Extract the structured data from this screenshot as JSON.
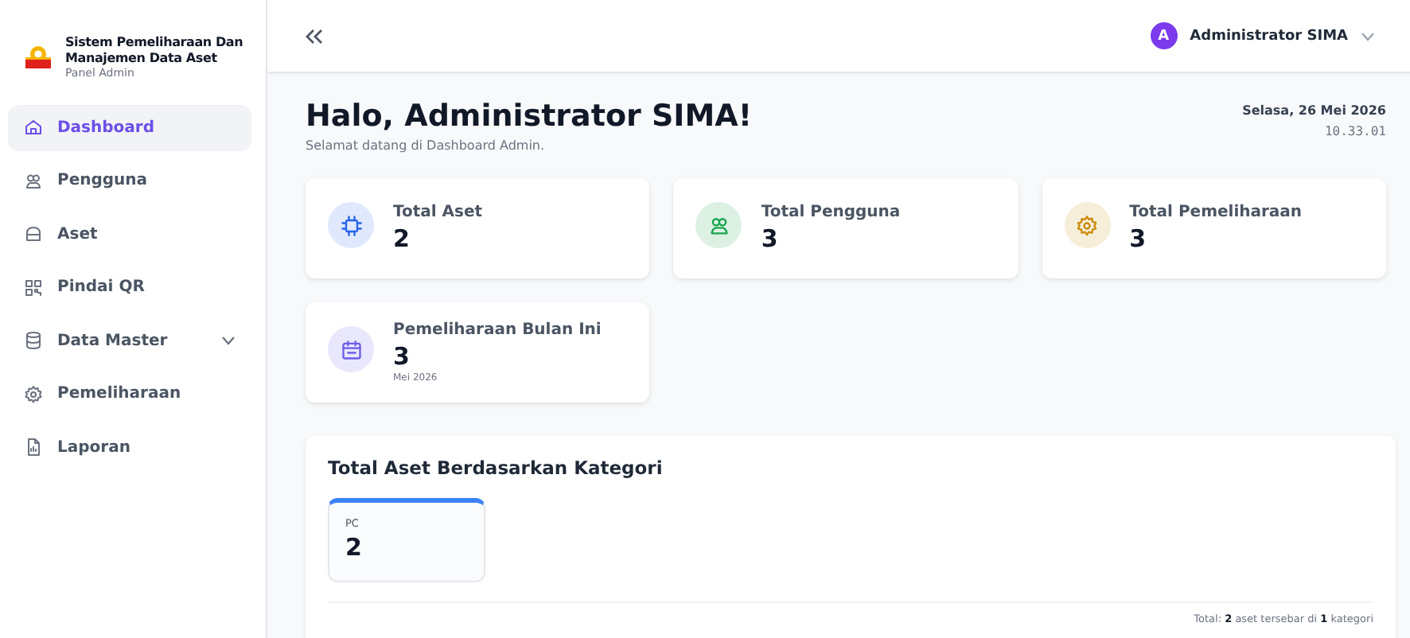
{
  "brand": {
    "title": "Sistem Pemeliharaan Dan Manajemen Data Aset",
    "subtitle": "Panel Admin"
  },
  "sidebar": {
    "items": [
      {
        "label": "Dashboard",
        "kind": "link",
        "selected": true
      },
      {
        "label": "Pengguna",
        "kind": "link",
        "selected": false
      },
      {
        "label": "Aset",
        "kind": "link",
        "selected": false
      },
      {
        "label": "Pindai QR",
        "kind": "link",
        "selected": false
      },
      {
        "label": "Data Master",
        "kind": "group",
        "selected": false,
        "expanded": false
      },
      {
        "label": "Pemeliharaan",
        "kind": "link",
        "selected": false
      },
      {
        "label": "Laporan",
        "kind": "link",
        "selected": false
      }
    ]
  },
  "header": {
    "user": {
      "initial": "A",
      "name": "Administrator SIMA"
    }
  },
  "greeting": {
    "title": "Halo, Administrator SIMA!",
    "subtitle": "Selamat datang di Dashboard Admin.",
    "date": "Selasa, 26 Mei 2026",
    "time": "10.33.01"
  },
  "stats": [
    {
      "label": "Total Aset",
      "value": "2",
      "color": "#2563eb"
    },
    {
      "label": "Total Pengguna",
      "value": "3",
      "color": "#16a34a"
    },
    {
      "label": "Total Pemeliharaan",
      "value": "3",
      "color": "#ca8a04"
    },
    {
      "label": "Pemeliharaan Bulan Ini",
      "value": "3",
      "color": "#6d5ce8",
      "note": "Mei 2026"
    }
  ],
  "categories": {
    "title": "Total Aset Berdasarkan Kategori",
    "items": [
      {
        "name": "PC",
        "count": "2",
        "color": "#3b82f6"
      }
    ],
    "footer": "Total: **2** aset tersebar di **1** kategori"
  }
}
